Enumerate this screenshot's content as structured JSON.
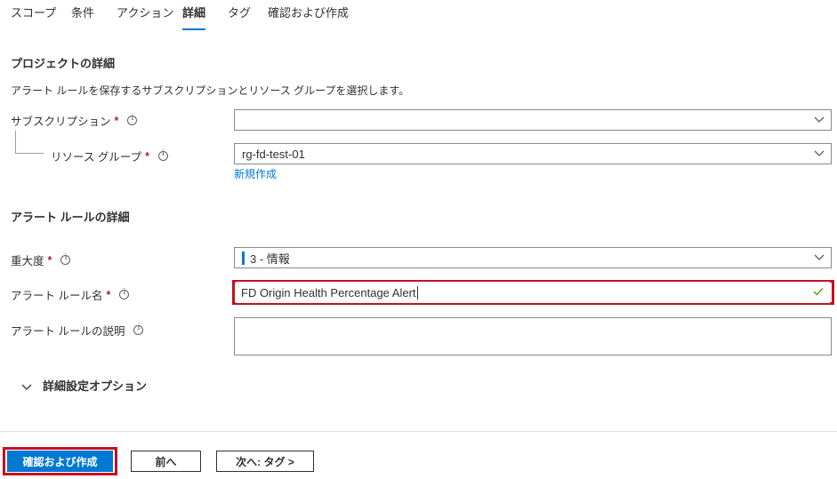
{
  "tabs": [
    {
      "label": "スコープ"
    },
    {
      "label": "条件"
    },
    {
      "label": "アクション"
    },
    {
      "label": "詳細"
    },
    {
      "label": "タグ"
    },
    {
      "label": "確認および作成"
    }
  ],
  "project": {
    "title": "プロジェクトの詳細",
    "description": "アラート ルールを保存するサブスクリプションとリソース グループを選択します。",
    "subscription": {
      "label": "サブスクリプション",
      "required": "*",
      "value": ""
    },
    "resource_group": {
      "label": "リソース グループ",
      "required": "*",
      "value": "rg-fd-test-01"
    },
    "create_new_link": "新規作成"
  },
  "alert_rule": {
    "title": "アラート ルールの詳細",
    "severity": {
      "label": "重大度",
      "required": "*",
      "value": "3 - 情報"
    },
    "name": {
      "label": "アラート ルール名",
      "required": "*",
      "value": "FD Origin Health Percentage Alert"
    },
    "description_field": {
      "label": "アラート ルールの説明",
      "value": ""
    }
  },
  "advanced": {
    "label": "詳細設定オプション"
  },
  "footer": {
    "review_create": "確認および作成",
    "previous": "前へ",
    "next": "次へ: タグ >"
  },
  "colors": {
    "accent": "#0078d4",
    "highlight": "#c50f1f",
    "valid": "#57a300"
  }
}
